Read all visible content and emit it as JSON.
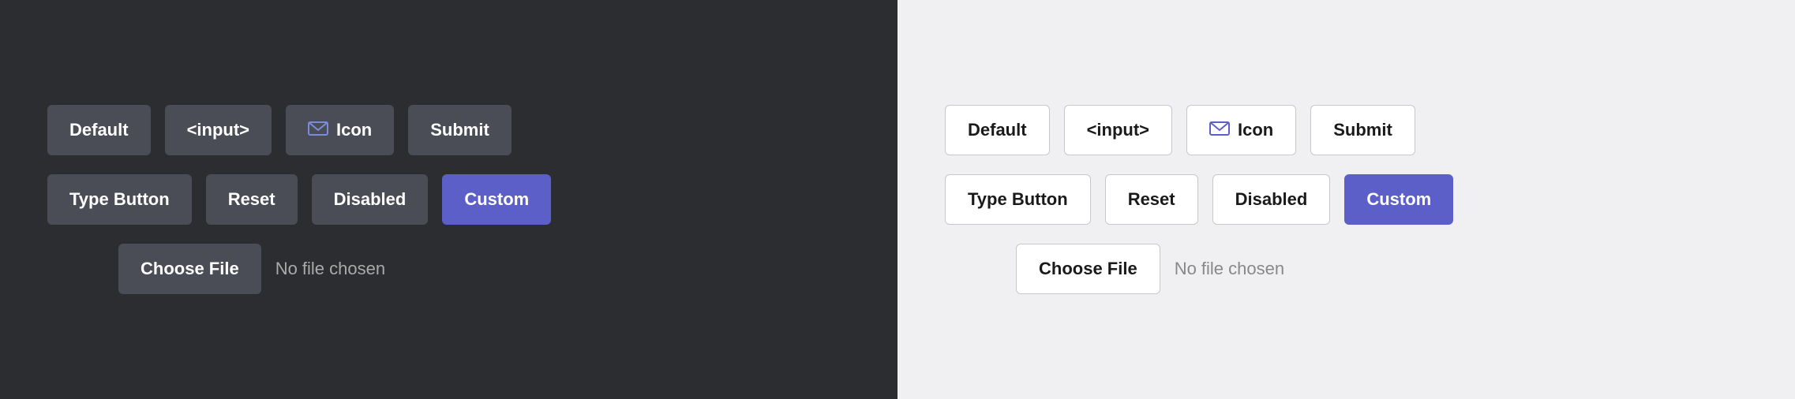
{
  "dark": {
    "row1": {
      "default_label": "Default",
      "input_label": "<input>",
      "icon_label": "Icon",
      "submit_label": "Submit"
    },
    "row2": {
      "type_button_label": "Type Button",
      "reset_label": "Reset",
      "disabled_label": "Disabled",
      "custom_label": "Custom"
    },
    "file": {
      "choose_label": "Choose File",
      "no_file_label": "No file chosen"
    }
  },
  "light": {
    "row1": {
      "default_label": "Default",
      "input_label": "<input>",
      "icon_label": "Icon",
      "submit_label": "Submit"
    },
    "row2": {
      "type_button_label": "Type Button",
      "reset_label": "Reset",
      "disabled_label": "Disabled",
      "custom_label": "Custom"
    },
    "file": {
      "choose_label": "Choose File",
      "no_file_label": "No file chosen"
    }
  }
}
